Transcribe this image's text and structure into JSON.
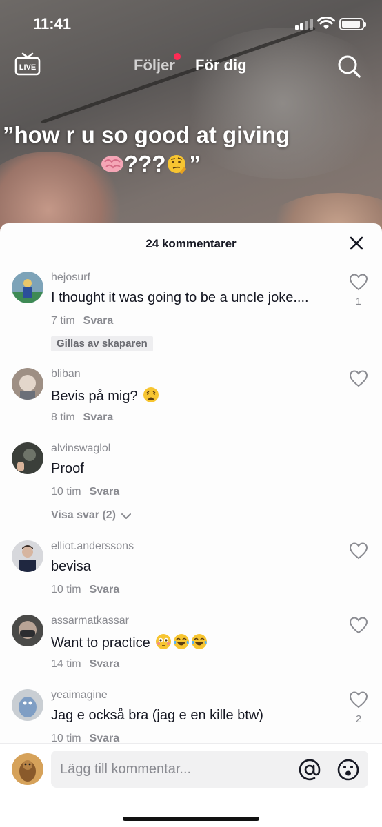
{
  "status_bar": {
    "time": "11:41"
  },
  "top_nav": {
    "live_label": "LIVE",
    "tab_following": "Följer",
    "tab_for_you": "För dig"
  },
  "video": {
    "caption_line1": "”how r u so good at giving",
    "caption_line2_text": "???",
    "caption_line2_end": "”"
  },
  "comments_sheet": {
    "title": "24 kommentarer",
    "comments": [
      {
        "username": "hejosurf",
        "text": "I thought it was going to be a uncle joke....",
        "time": "7 tim",
        "reply_label": "Svara",
        "likes": "1",
        "badge": "Gillas av skaparen"
      },
      {
        "username": "bliban",
        "text": "Bevis på mig?",
        "time": "8 tim",
        "reply_label": "Svara",
        "likes": ""
      },
      {
        "username": "alvinswaglol",
        "text": "Proof",
        "time": "10 tim",
        "reply_label": "Svara",
        "likes": "",
        "view_replies": "Visa svar (2)"
      },
      {
        "username": "elliot.anderssons",
        "text": "bevisa",
        "time": "10 tim",
        "reply_label": "Svara",
        "likes": ""
      },
      {
        "username": "assarmatkassar",
        "text": "Want to practice",
        "time": "14 tim",
        "reply_label": "Svara",
        "likes": ""
      },
      {
        "username": "yeaimagine",
        "text": "Jag e också bra (jag e en kille btw)",
        "time": "10 tim",
        "reply_label": "Svara",
        "likes": "2"
      }
    ]
  },
  "input_bar": {
    "placeholder": "Lägg till kommentar..."
  },
  "colors": {
    "accent_red": "#fe2c55",
    "text_primary": "#161823",
    "text_secondary": "#8a8b91"
  }
}
